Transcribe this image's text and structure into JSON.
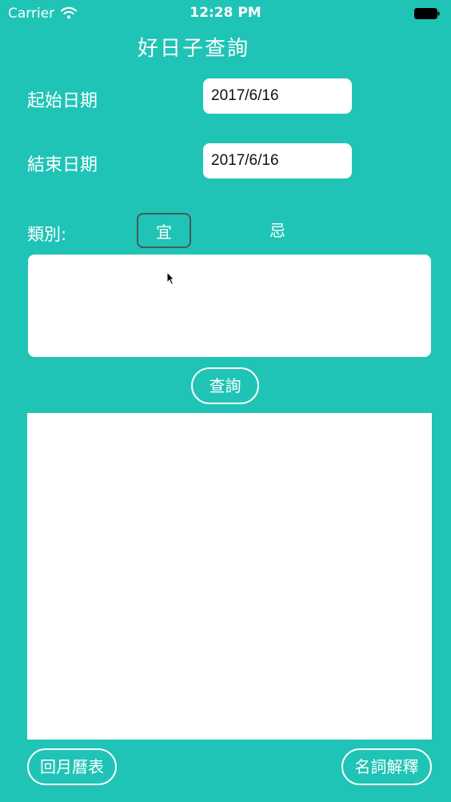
{
  "status_bar": {
    "carrier": "Carrier",
    "time": "12:28 PM",
    "icons": [
      "wifi-icon",
      "battery-icon"
    ]
  },
  "page": {
    "title": "好日子查詢",
    "background_color": "#1fc4b6"
  },
  "form": {
    "start_date": {
      "label": "起始日期",
      "value": "2017/6/16"
    },
    "end_date": {
      "label": "結束日期",
      "value": "2017/6/16"
    },
    "category": {
      "label": "類別:",
      "options": [
        "宜",
        "忌"
      ],
      "selected": "宜"
    },
    "text_area_value": "",
    "query_button": "查詢"
  },
  "results": {
    "content": ""
  },
  "footer": {
    "back_button": "回月曆表",
    "glossary_button": "名詞解釋"
  }
}
